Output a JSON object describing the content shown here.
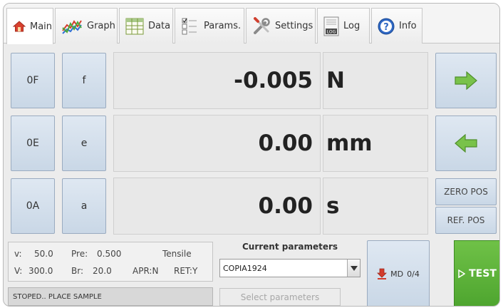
{
  "tabs": [
    {
      "label": "Main",
      "icon": "home-icon",
      "active": true
    },
    {
      "label": "Graph",
      "icon": "graph-icon"
    },
    {
      "label": "Data",
      "icon": "table-icon"
    },
    {
      "label": "Params.",
      "icon": "checklist-icon"
    },
    {
      "label": "Settings",
      "icon": "tools-icon"
    },
    {
      "label": "Log",
      "icon": "log-icon",
      "icon_text": "LOG"
    },
    {
      "label": "Info",
      "icon": "help-icon",
      "icon_text": "?"
    }
  ],
  "readouts": [
    {
      "zero_label": "0F",
      "select_label": "f",
      "value": "-0.005",
      "unit": "N"
    },
    {
      "zero_label": "0E",
      "select_label": "e",
      "value": "0.00",
      "unit": "mm"
    },
    {
      "zero_label": "0A",
      "select_label": "a",
      "value": "0.00",
      "unit": "s"
    }
  ],
  "right_panel": {
    "zero_pos": "ZERO POS",
    "ref_pos": "REF. POS",
    "up_icon": "arrow-right-icon",
    "down_icon": "arrow-left-icon"
  },
  "info": {
    "v_label": "v:",
    "v_value": "50.0",
    "pre_label": "Pre:",
    "pre_value": "0.500",
    "mode": "Tensile",
    "V_label": "V:",
    "V_value": "300.0",
    "br_label": "Br:",
    "br_value": "20.0",
    "apr": "APR:N",
    "ret": "RET:Y"
  },
  "status": "STOPED.. PLACE SAMPLE",
  "parameters": {
    "title": "Current parameters",
    "selected": "COPIA1924",
    "select_button": "Select parameters"
  },
  "md_button": {
    "label": "MD",
    "count": "0/4"
  },
  "test_button": {
    "label": "TEST"
  },
  "colors": {
    "accent_green": "#5cb335",
    "button_blue": "#d4e0ec",
    "arrow_green": "#79c24a"
  }
}
